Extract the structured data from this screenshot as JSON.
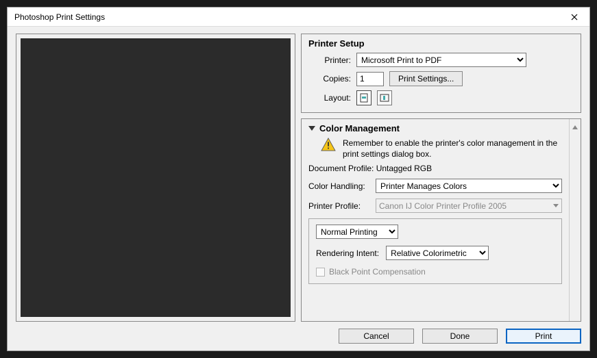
{
  "window": {
    "title": "Photoshop Print Settings"
  },
  "printer_setup": {
    "legend": "Printer Setup",
    "printer_label": "Printer:",
    "printer_value": "Microsoft Print to PDF",
    "copies_label": "Copies:",
    "copies_value": "1",
    "print_settings_btn": "Print Settings...",
    "layout_label": "Layout:"
  },
  "color_mgmt": {
    "legend": "Color Management",
    "warning": "Remember to enable the printer's color management in the print settings dialog box.",
    "doc_profile": "Document Profile: Untagged RGB",
    "color_handling_label": "Color Handling:",
    "color_handling_value": "Printer Manages Colors",
    "printer_profile_label": "Printer Profile:",
    "printer_profile_value": "Canon IJ Color Printer Profile 2005",
    "normal_printing": "Normal Printing",
    "rendering_intent_label": "Rendering Intent:",
    "rendering_intent_value": "Relative Colorimetric",
    "bpc_label": "Black Point Compensation"
  },
  "footer": {
    "cancel": "Cancel",
    "done": "Done",
    "print": "Print"
  }
}
